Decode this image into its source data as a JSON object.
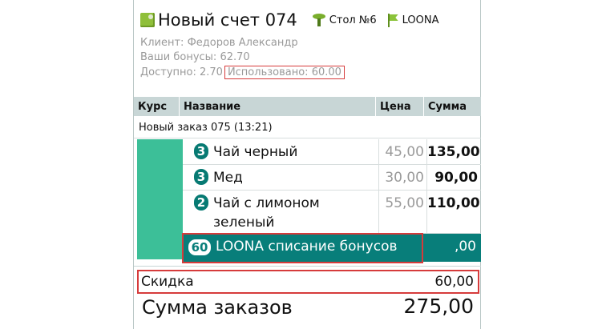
{
  "header": {
    "title": "Новый счет 074",
    "table_label": "Стол №6",
    "org_label": "LOONA"
  },
  "info": {
    "client": "Клиент: Федоров Александр",
    "bonuses": "Ваши бонусы: 62.70",
    "available": "Доступно: 2.70",
    "used": "Использовано: 60.00"
  },
  "columns": {
    "course": "Курс",
    "name": "Название",
    "price": "Цена",
    "sum": "Сумма"
  },
  "order": {
    "header": "Новый заказ 075 (13:21)",
    "items": [
      {
        "qty": "3",
        "name": "Чай черный",
        "price": "45,00",
        "sum": "135,00"
      },
      {
        "qty": "3",
        "name": "Мед",
        "price": "30,00",
        "sum": "90,00"
      },
      {
        "qty": "2",
        "name": "Чай с лимоном зеленый",
        "price": "55,00",
        "sum": "110,00"
      }
    ],
    "bonus_item": {
      "qty": "60",
      "name": "LOONA списание бонусов",
      "sum": ",00"
    }
  },
  "summary": {
    "discount_label": "Скидка",
    "discount_value": "60,00",
    "total_label": "Сумма заказов",
    "total_value": "275,00"
  },
  "colors": {
    "accent_teal": "#087e7a",
    "course_green": "#3cbf98",
    "header_bg": "#c8d6d6",
    "highlight_red": "#d63b3b"
  }
}
